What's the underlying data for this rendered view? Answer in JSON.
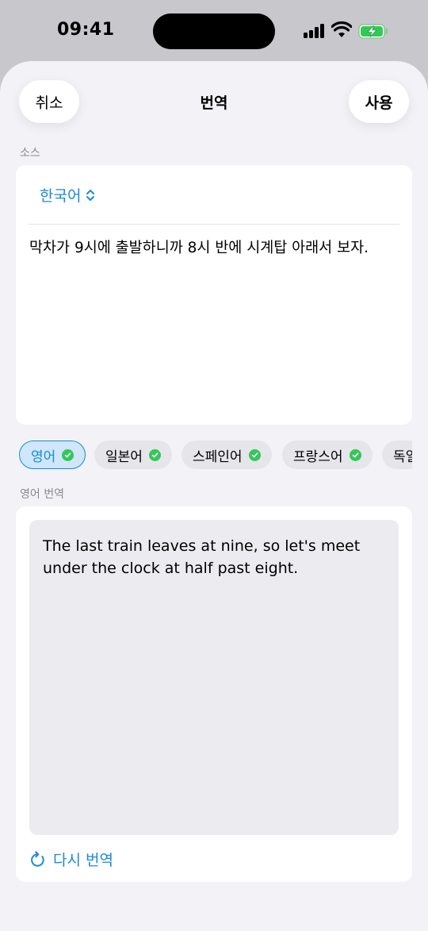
{
  "status_bar": {
    "time": "09:41"
  },
  "nav": {
    "cancel_label": "취소",
    "title": "번역",
    "use_label": "사용"
  },
  "source": {
    "section_label": "소스",
    "language": "한국어",
    "text": "막차가 9시에 출발하니까 8시 반에 시계탑 아래서 보자."
  },
  "target_languages": [
    {
      "label": "영어",
      "selected": true,
      "done": true
    },
    {
      "label": "일본어",
      "selected": false,
      "done": true
    },
    {
      "label": "스페인어",
      "selected": false,
      "done": true
    },
    {
      "label": "프랑스어",
      "selected": false,
      "done": true
    },
    {
      "label": "독일",
      "selected": false,
      "done": false
    }
  ],
  "result": {
    "section_label": "영어 번역",
    "text": "The last train leaves at nine, so let's meet under the clock at half past eight.",
    "retranslate_label": "다시 번역"
  },
  "colors": {
    "accent": "#1a8bd6",
    "check": "#34c759",
    "background": "#f2f2f7"
  }
}
